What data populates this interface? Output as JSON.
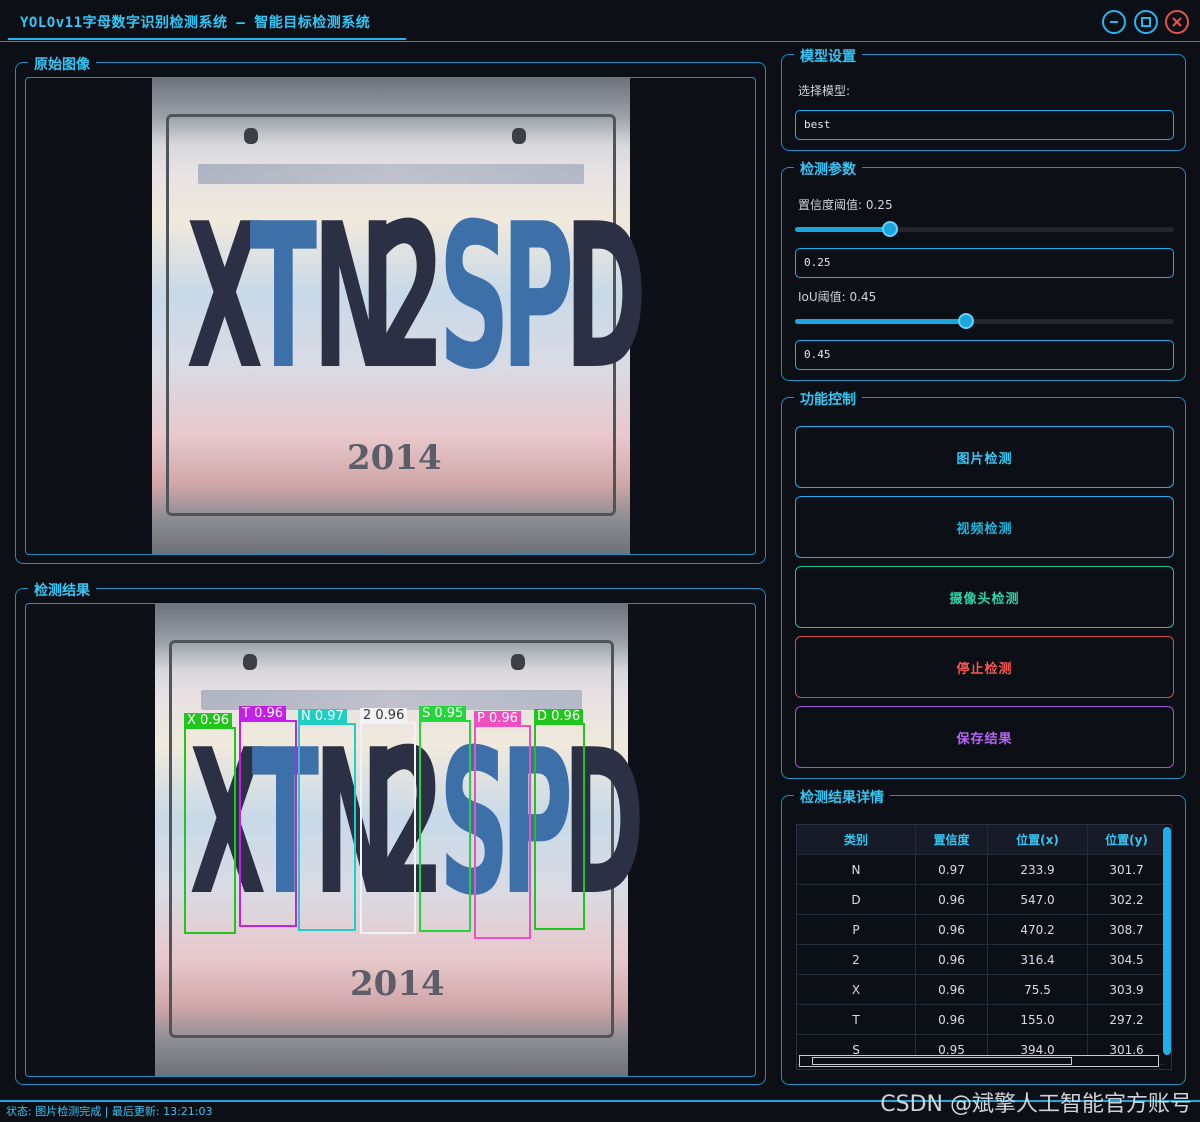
{
  "window": {
    "title": "YOLOv11字母数字识别检测系统 – 智能目标检测系统",
    "accent": "#33c6f5"
  },
  "panels": {
    "original_title": "原始图像",
    "result_title": "检测结果",
    "model_title": "模型设置",
    "params_title": "检测参数",
    "control_title": "功能控制",
    "details_title": "检测结果详情"
  },
  "plate": {
    "characters": [
      "X",
      "T",
      "N",
      "2",
      "S",
      "P",
      "D"
    ],
    "year": "2014"
  },
  "detections": [
    {
      "label": "X 0.96",
      "color": "#22c51d"
    },
    {
      "label": "T 0.96",
      "color": "#c41ee8"
    },
    {
      "label": "N 0.97",
      "color": "#1fd0c2"
    },
    {
      "label": "2 0.96",
      "color": "#f2f2f5"
    },
    {
      "label": "S 0.95",
      "color": "#22d63c"
    },
    {
      "label": "P 0.96",
      "color": "#ef4fc0"
    },
    {
      "label": "D 0.96",
      "color": "#22c51d"
    }
  ],
  "model": {
    "select_label": "选择模型:",
    "value": "best"
  },
  "params": {
    "conf_label": "置信度阈值: 0.25",
    "conf_value": "0.25",
    "conf_fraction": 0.25,
    "iou_label": "IoU阈值: 0.45",
    "iou_value": "0.45",
    "iou_fraction": 0.45
  },
  "controls": {
    "image_detect": "图片检测",
    "video_detect": "视频检测",
    "camera_detect": "摄像头检测",
    "stop_detect": "停止检测",
    "save_result": "保存结果"
  },
  "table": {
    "headers": [
      "类别",
      "置信度",
      "位置(x)",
      "位置(y)"
    ],
    "rows": [
      [
        "N",
        "0.97",
        "233.9",
        "301.7"
      ],
      [
        "D",
        "0.96",
        "547.0",
        "302.2"
      ],
      [
        "P",
        "0.96",
        "470.2",
        "308.7"
      ],
      [
        "2",
        "0.96",
        "316.4",
        "304.5"
      ],
      [
        "X",
        "0.96",
        "75.5",
        "303.9"
      ],
      [
        "T",
        "0.96",
        "155.0",
        "297.2"
      ],
      [
        "S",
        "0.95",
        "394.0",
        "301.6"
      ]
    ]
  },
  "status": {
    "text": "状态: 图片检测完成 | 最后更新: 13:21:03"
  },
  "watermark": "CSDN @斌擎人工智能官方账号"
}
